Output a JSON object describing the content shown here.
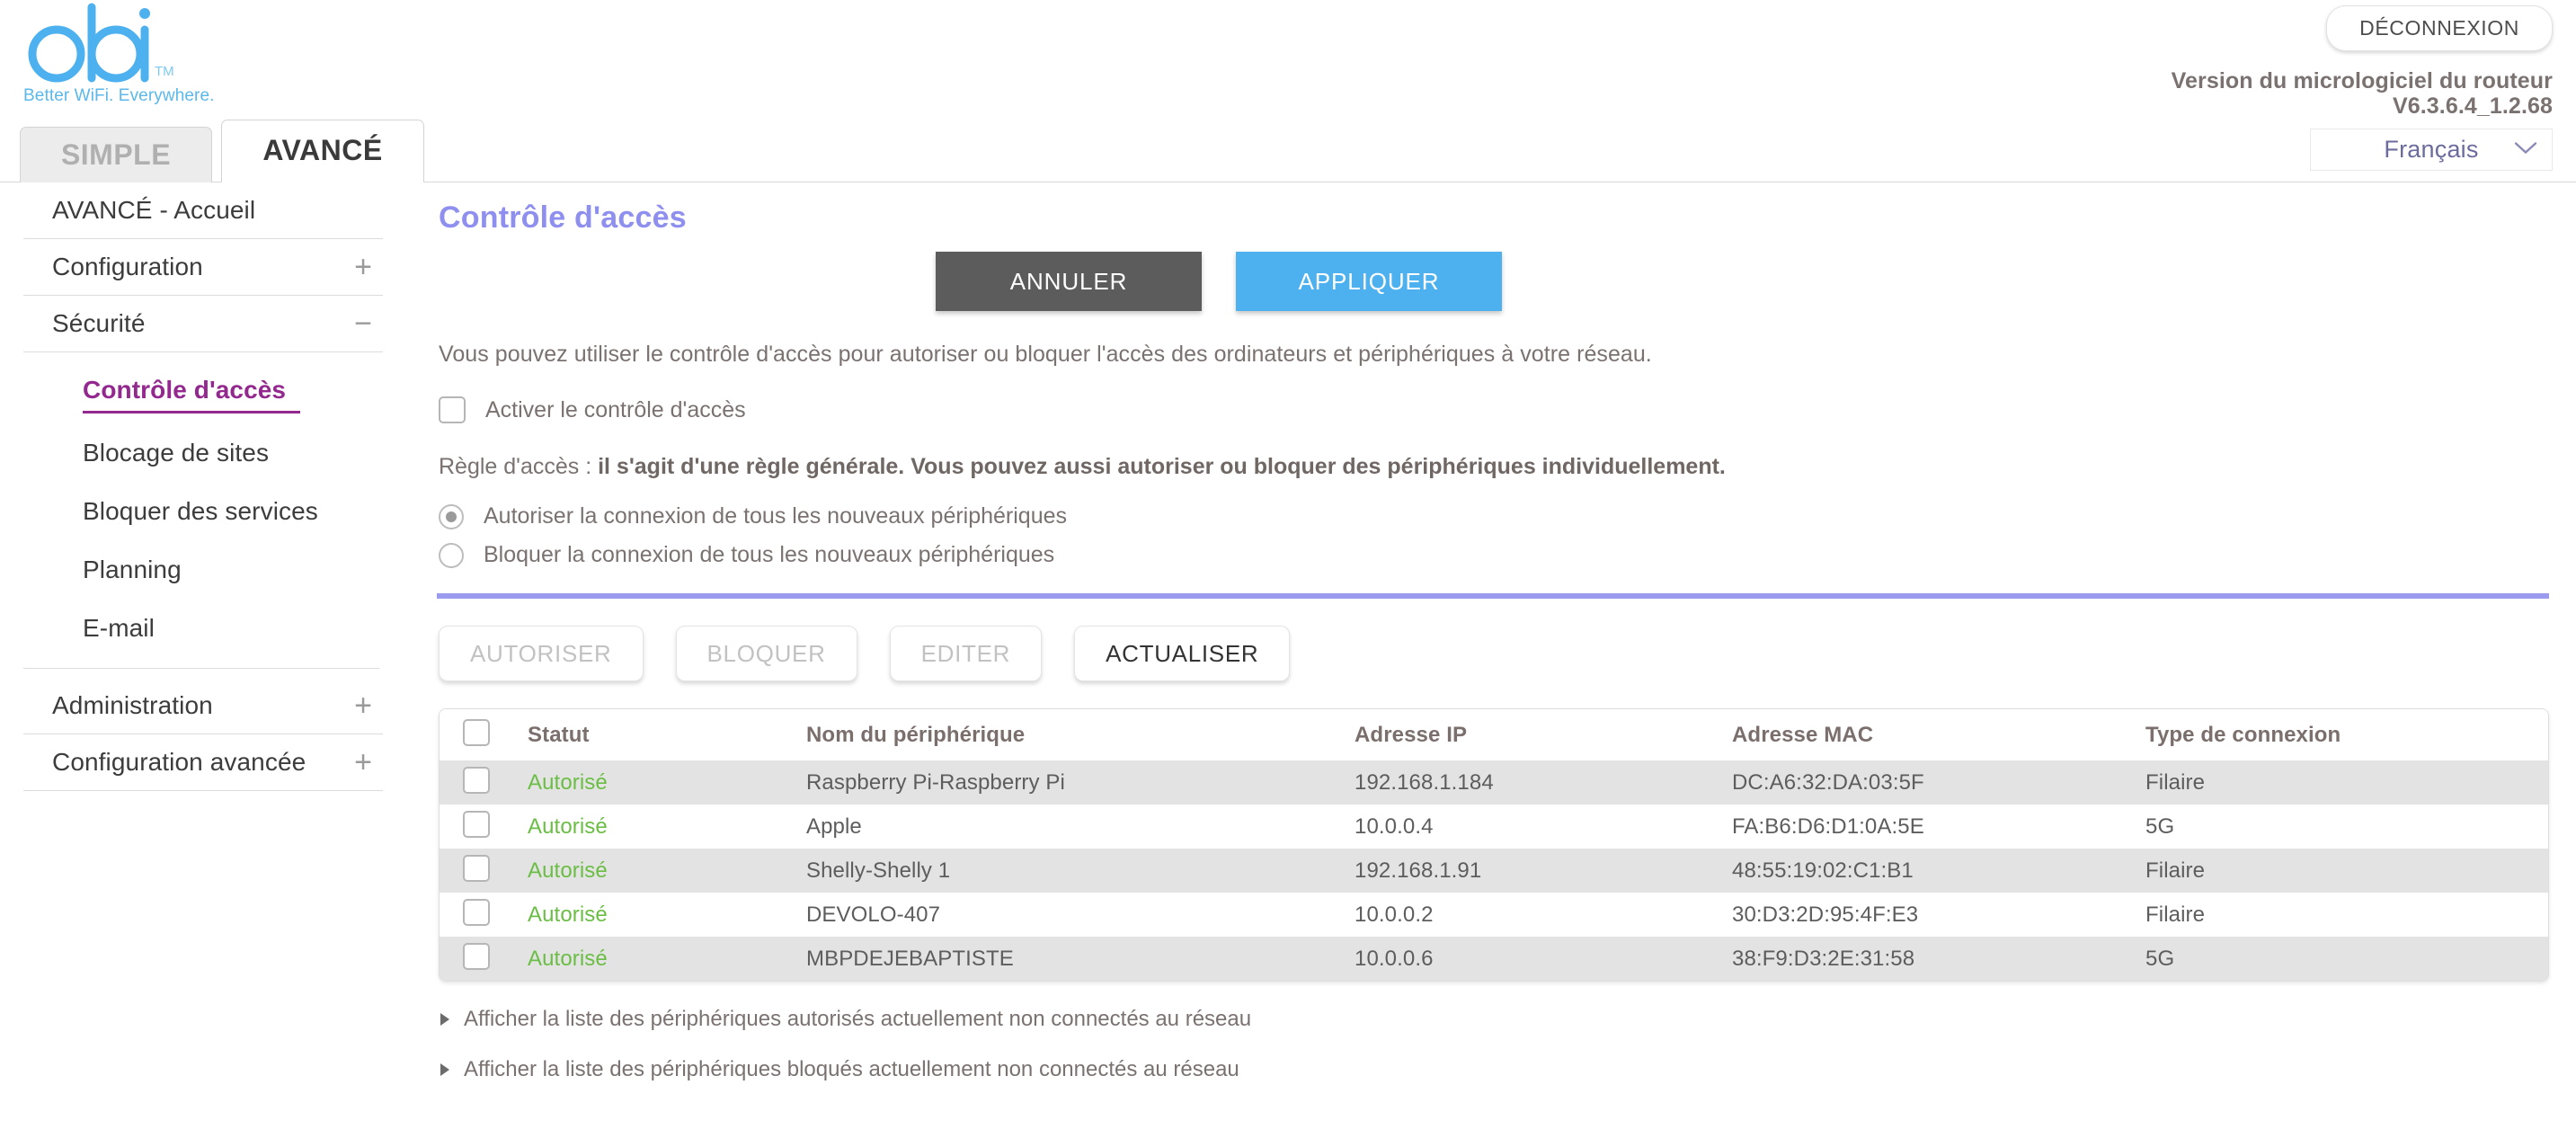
{
  "header": {
    "logo_text": "orbi",
    "logo_tm": "TM",
    "tagline": "Better WiFi. Everywhere.",
    "logout_label": "DÉCONNEXION",
    "firmware_label": "Version du micrologiciel du routeur",
    "firmware_version": "V6.3.6.4_1.2.68",
    "language_selected": "Français",
    "brand_blue": "#5bb8ea",
    "accent_purple": "#9a9aee"
  },
  "tabs": [
    {
      "label": "SIMPLE",
      "active": false
    },
    {
      "label": "AVANCÉ",
      "active": true
    }
  ],
  "sidebar": {
    "home_label": "AVANCÉ - Accueil",
    "groups": [
      {
        "label": "Configuration",
        "sign": "+",
        "expanded": false
      },
      {
        "label": "Sécurité",
        "sign": "−",
        "expanded": true
      }
    ],
    "security_items": [
      {
        "label": "Contrôle d'accès",
        "selected": true
      },
      {
        "label": "Blocage de sites",
        "selected": false
      },
      {
        "label": "Bloquer des services",
        "selected": false
      },
      {
        "label": "Planning",
        "selected": false
      },
      {
        "label": "E-mail",
        "selected": false
      }
    ],
    "bottom_groups": [
      {
        "label": "Administration",
        "sign": "+"
      },
      {
        "label": "Configuration avancée",
        "sign": "+"
      }
    ]
  },
  "main": {
    "page_title": "Contrôle d'accès",
    "cancel_label": "ANNULER",
    "apply_label": "APPLIQUER",
    "intro": "Vous pouvez utiliser le contrôle d'accès pour autoriser ou bloquer l'accès des ordinateurs et périphériques à votre réseau.",
    "enable_checkbox_label": "Activer le contrôle d'accès",
    "enable_checkbox_checked": false,
    "rule_prefix": "Règle d'accès : ",
    "rule_bold": "il s'agit d'une règle générale. Vous pouvez aussi autoriser ou bloquer des périphériques individuellement.",
    "radios": [
      {
        "label": "Autoriser la connexion de tous les nouveaux périphériques",
        "selected": true
      },
      {
        "label": "Bloquer la connexion de tous les nouveaux périphériques",
        "selected": false
      }
    ],
    "table_buttons": [
      {
        "label": "AUTORISER",
        "enabled": false
      },
      {
        "label": "BLOQUER",
        "enabled": false
      },
      {
        "label": "EDITER",
        "enabled": false
      },
      {
        "label": "ACTUALISER",
        "enabled": true
      }
    ],
    "table": {
      "columns": [
        "Statut",
        "Nom du périphérique",
        "Adresse IP",
        "Adresse MAC",
        "Type de connexion"
      ],
      "rows": [
        {
          "checked": false,
          "status": "Autorisé",
          "name": "Raspberry Pi-Raspberry Pi",
          "ip": "192.168.1.184",
          "mac": "DC:A6:32:DA:03:5F",
          "type": "Filaire"
        },
        {
          "checked": false,
          "status": "Autorisé",
          "name": "Apple",
          "ip": "10.0.0.4",
          "mac": "FA:B6:D6:D1:0A:5E",
          "type": "5G"
        },
        {
          "checked": false,
          "status": "Autorisé",
          "name": "Shelly-Shelly 1",
          "ip": "192.168.1.91",
          "mac": "48:55:19:02:C1:B1",
          "type": "Filaire"
        },
        {
          "checked": false,
          "status": "Autorisé",
          "name": "DEVOLO-407",
          "ip": "10.0.0.2",
          "mac": "30:D3:2D:95:4F:E3",
          "type": "Filaire"
        },
        {
          "checked": false,
          "status": "Autorisé",
          "name": "MBPDEJEBAPTISTE",
          "ip": "10.0.0.6",
          "mac": "38:F9:D3:2E:31:58",
          "type": "5G"
        }
      ]
    },
    "expanders": [
      {
        "label": "Afficher la liste des périphériques autorisés actuellement non connectés au réseau"
      },
      {
        "label": "Afficher la liste des périphériques bloqués actuellement non connectés au réseau"
      }
    ]
  }
}
